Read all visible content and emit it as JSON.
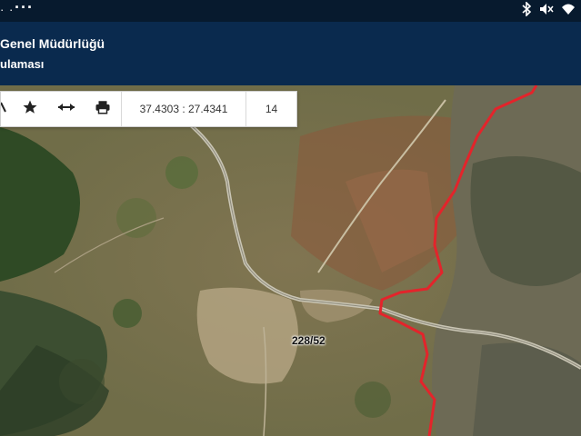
{
  "status_bar": {
    "left_dots": "· ·",
    "more": "···",
    "icons": [
      "bluetooth-icon",
      "mute-icon",
      "wifi-icon"
    ]
  },
  "header": {
    "title_fragment": "Genel Müdürlüğü",
    "subtitle_fragment": "ulaması",
    "background": "#0a2a4e"
  },
  "toolbar": {
    "coordinates": "37.4303 : 27.4341",
    "zoom": "14",
    "buttons": [
      "location-icon",
      "star-icon",
      "measure-icon",
      "print-icon"
    ]
  },
  "map": {
    "parcel_label": "228/52",
    "boundary_color": "#e3242b"
  }
}
